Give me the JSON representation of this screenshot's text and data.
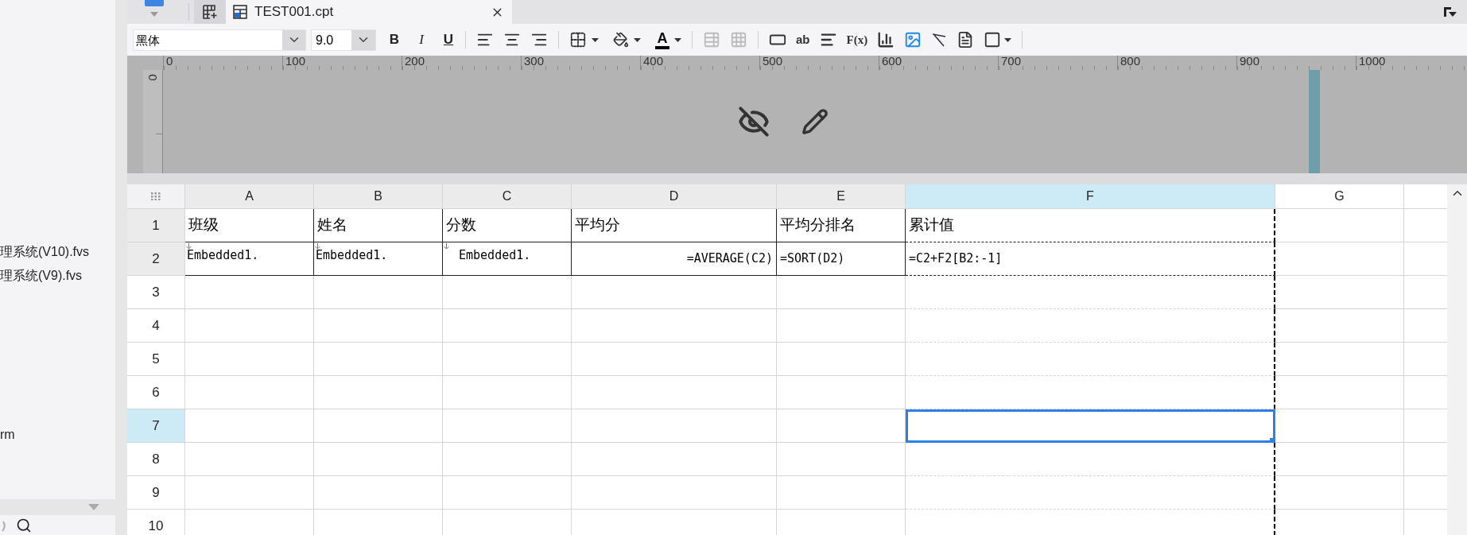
{
  "sidebar": {
    "files": [
      {
        "name": "理系统(V10).fvs"
      },
      {
        "name": "理系统(V9).fvs"
      },
      {
        "name": "rm"
      }
    ]
  },
  "tabs": [
    {
      "title": "TEST001.cpt",
      "selected": true
    }
  ],
  "toolbar": {
    "font_family": "黑体",
    "font_size": "9.0",
    "style_buttons": [
      {
        "kind": "bold",
        "label": "B"
      },
      {
        "kind": "italic",
        "label": "I"
      },
      {
        "kind": "underline",
        "label": "U"
      }
    ],
    "font_color_label": "A",
    "text_tool_label": "ab",
    "formula_tool_label": "F(x)"
  },
  "ruler": {
    "horizontal_labels": [
      "0",
      "100",
      "200",
      "300",
      "400",
      "500",
      "600",
      "700",
      "800",
      "900",
      "1000"
    ],
    "vertical_label": "0"
  },
  "sheet": {
    "columns": [
      {
        "label": "A",
        "selected": false
      },
      {
        "label": "B",
        "selected": false
      },
      {
        "label": "C",
        "selected": false
      },
      {
        "label": "D",
        "selected": false
      },
      {
        "label": "E",
        "selected": false
      },
      {
        "label": "F",
        "selected": true
      },
      {
        "label": "G",
        "selected": false
      }
    ],
    "rows": [
      {
        "label": "1",
        "selected": false,
        "cells": [
          {
            "kind": "header",
            "text": "班级"
          },
          {
            "kind": "header",
            "text": "姓名"
          },
          {
            "kind": "header",
            "text": "分数"
          },
          {
            "kind": "header",
            "text": "平均分"
          },
          {
            "kind": "header",
            "text": "平均分排名"
          },
          {
            "kind": "header",
            "text": "累计值"
          }
        ]
      },
      {
        "label": "2",
        "selected": false,
        "cells": [
          {
            "kind": "expand",
            "text": "Embedded1."
          },
          {
            "kind": "expand",
            "text": "Embedded1."
          },
          {
            "kind": "expand_indented",
            "text": "Embedded1."
          },
          {
            "kind": "formula_right",
            "text": "=AVERAGE(C2)"
          },
          {
            "kind": "formula",
            "text": "=SORT(D2)"
          },
          {
            "kind": "formula",
            "text": "=C2+F2[B2:-1]"
          }
        ]
      },
      {
        "label": "3",
        "selected": false
      },
      {
        "label": "4",
        "selected": false
      },
      {
        "label": "5",
        "selected": false
      },
      {
        "label": "6",
        "selected": false
      },
      {
        "label": "7",
        "selected": true
      },
      {
        "label": "8",
        "selected": false
      },
      {
        "label": "9",
        "selected": false
      },
      {
        "label": "10",
        "selected": false
      }
    ]
  }
}
